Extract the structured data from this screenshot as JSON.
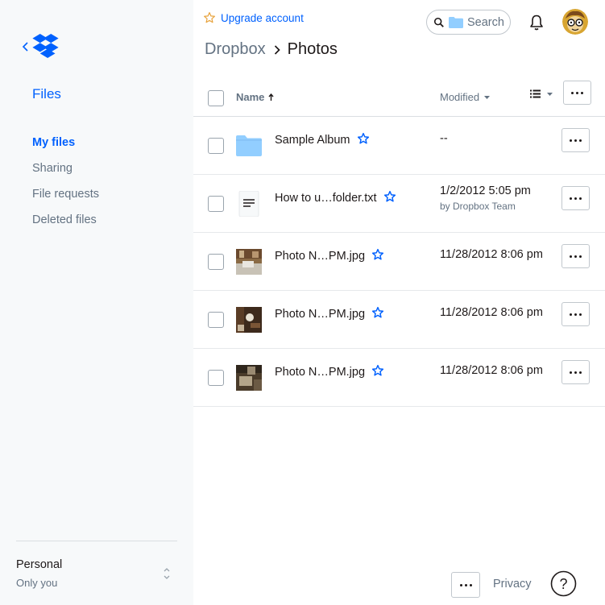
{
  "sidebar": {
    "section_title": "Files",
    "items": [
      {
        "label": "My files",
        "active": true
      },
      {
        "label": "Sharing",
        "active": false
      },
      {
        "label": "File requests",
        "active": false
      },
      {
        "label": "Deleted files",
        "active": false
      }
    ],
    "account": {
      "name": "Personal",
      "subtitle": "Only you"
    }
  },
  "header": {
    "upgrade_label": "Upgrade account",
    "search_placeholder": "Search",
    "breadcrumb": {
      "root": "Dropbox",
      "current": "Photos"
    }
  },
  "table": {
    "columns": {
      "name": "Name",
      "modified": "Modified"
    },
    "rows": [
      {
        "name": "Sample Album",
        "icon": "folder-icon",
        "modified": "--",
        "modified_by": ""
      },
      {
        "name": "How to u…folder.txt",
        "icon": "text-file-icon",
        "modified": "1/2/2012 5:05 pm",
        "modified_by": "by Dropbox Team"
      },
      {
        "name": "Photo N…PM.jpg",
        "icon": "photo-thumbnail",
        "modified": "11/28/2012 8:06 pm",
        "modified_by": ""
      },
      {
        "name": "Photo N…PM.jpg",
        "icon": "photo-thumbnail",
        "modified": "11/28/2012 8:06 pm",
        "modified_by": ""
      },
      {
        "name": "Photo N…PM.jpg",
        "icon": "photo-thumbnail",
        "modified": "11/28/2012 8:06 pm",
        "modified_by": ""
      }
    ]
  },
  "footer": {
    "privacy_label": "Privacy",
    "help_label": "?"
  },
  "colors": {
    "accent": "#0061fe",
    "muted": "#637282",
    "sidebar_bg": "#f7f9fa",
    "folder": "#92ceff"
  }
}
